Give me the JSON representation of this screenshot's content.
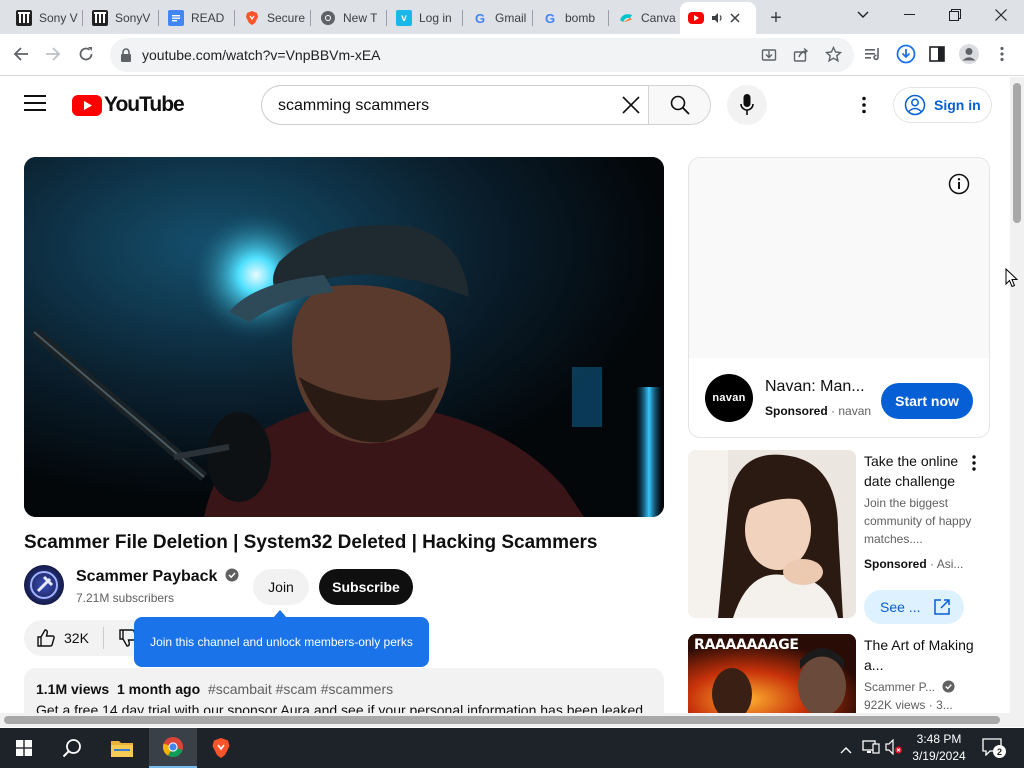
{
  "browser": {
    "tabs": [
      {
        "title": "Sony V",
        "icon": "sony-icon",
        "active": false
      },
      {
        "title": "SonyV",
        "icon": "sony-icon",
        "active": false
      },
      {
        "title": "READ",
        "icon": "docs-icon",
        "active": false
      },
      {
        "title": "Secure",
        "icon": "brave-icon",
        "active": false
      },
      {
        "title": "New T",
        "icon": "chrome-icon",
        "active": false
      },
      {
        "title": "Log in",
        "icon": "vimeo-icon",
        "active": false
      },
      {
        "title": "Gmail",
        "icon": "google-icon",
        "active": false
      },
      {
        "title": "bomb",
        "icon": "google-icon",
        "active": false
      },
      {
        "title": "Canva",
        "icon": "canva-icon",
        "active": false
      },
      {
        "title": "",
        "icon": "youtube-icon",
        "active": true,
        "audio": true
      }
    ],
    "new_tab": "+",
    "url": "youtube.com/watch?v=VnpBBVm-xEA"
  },
  "youtube": {
    "logo_text": "YouTube",
    "search_query": "scamming scammers",
    "sign_in": "Sign in",
    "video": {
      "title": "Scammer File Deletion | System32 Deleted | Hacking Scammers",
      "channel": "Scammer Payback",
      "subscribers": "7.21M subscribers",
      "join": "Join",
      "subscribe": "Subscribe",
      "likes": "32K",
      "tooltip": "Join this channel and unlock members-only perks",
      "views": "1.1M views",
      "age": "1 month ago",
      "tags": "#scambait #scam #scammers",
      "description_line": "Get a free 14 day trial with our sponsor Aura and see if your personal information has been leaked"
    },
    "ad": {
      "logo_text": "navan",
      "title": "Navan: Man...",
      "sponsored": "Sponsored",
      "domain": "navan",
      "cta": "Start now"
    },
    "rec1": {
      "title": "Take the online date challenge",
      "description": "Join the biggest community of happy matches....",
      "sponsored": "Sponsored",
      "domain": "Asi...",
      "button": "See ..."
    },
    "rec2": {
      "thumb_text": "RAAAAAAAGE",
      "title": "The Art of Making a...",
      "channel": "Scammer P...",
      "views": "922K views",
      "age_trunc": "3..."
    }
  },
  "taskbar": {
    "time": "3:48 PM",
    "date": "3/19/2024",
    "notifications": "2"
  },
  "colors": {
    "youtube_red": "#ff0000",
    "link_blue": "#065fd4",
    "tooltip_blue": "#1a73e8",
    "taskbar": "#1e2329"
  }
}
